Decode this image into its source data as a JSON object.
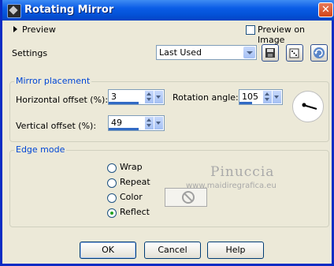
{
  "window": {
    "title": "Rotating Mirror",
    "close_icon": "close-icon"
  },
  "preview": {
    "label": "Preview",
    "preview_on_image_label": "Preview on Image"
  },
  "settings": {
    "label": "Settings",
    "preset_value": "Last Used"
  },
  "mirror_placement": {
    "legend": "Mirror placement",
    "horizontal_offset_label": "Horizontal offset (%):",
    "horizontal_offset_value": "3",
    "vertical_offset_label": "Vertical offset (%):",
    "vertical_offset_value": "49",
    "rotation_angle_label": "Rotation angle:",
    "rotation_angle_value": "105"
  },
  "edge_mode": {
    "legend": "Edge mode",
    "options": [
      "Wrap",
      "Repeat",
      "Color",
      "Reflect"
    ],
    "selected": "Reflect"
  },
  "watermark": {
    "name": "Pinuccia",
    "site": "www.maidiregrafica.eu"
  },
  "buttons": {
    "ok": "OK",
    "cancel": "Cancel",
    "help": "Help"
  },
  "colors": {
    "titlebar": "#0a5ce6",
    "accent": "#0046d5",
    "face": "#ece9d8"
  }
}
